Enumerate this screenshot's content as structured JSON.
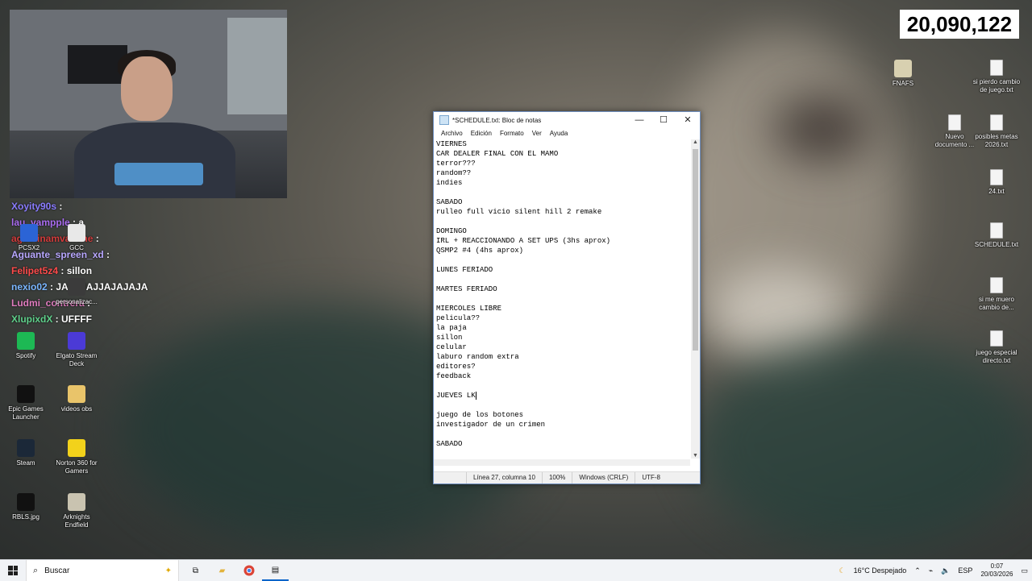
{
  "viewer_counter": "20,090,122",
  "chat": [
    {
      "user": "Xoyity90s",
      "user_color": "#8a7cff",
      "msg": ""
    },
    {
      "user": "lau_vampple",
      "user_color": "#a96cf0",
      "msg": "a"
    },
    {
      "user": "agustinamvallone",
      "user_color": "#d23b3b",
      "msg": ""
    },
    {
      "user": "Aguante_spreen_xd",
      "user_color": "#b8a7ff",
      "msg": ""
    },
    {
      "user": "Felipet5z4",
      "user_color": "#ff4b4b",
      "msg": "sillon"
    },
    {
      "user": "nexio02",
      "user_color": "#7ab6ff",
      "msg": "JAJAJAJJAJAJAJA"
    },
    {
      "user": "Ludmi_contrera",
      "user_color": "#e07cbf",
      "msg": ""
    },
    {
      "user": "XlupixdX",
      "user_color": "#5fd08b",
      "msg": "UFFFF"
    }
  ],
  "desktop_left": [
    {
      "label": "PCSX2",
      "icon": "pcsx2-icon"
    },
    {
      "label": "GCC",
      "icon": "gcc-icon"
    },
    {
      "label": "personalizac...",
      "icon": "personalize-icon"
    },
    {
      "label": "Spotify",
      "icon": "spotify-icon"
    },
    {
      "label": "Elgato Stream Deck",
      "icon": "stream-deck-icon"
    },
    {
      "label": "Epic Games Launcher",
      "icon": "epic-games-icon"
    },
    {
      "label": "videos obs",
      "icon": "folder-icon"
    },
    {
      "label": "Steam",
      "icon": "steam-icon"
    },
    {
      "label": "Norton 360 for Gamers",
      "icon": "norton-icon"
    },
    {
      "label": "RBLS.jpg",
      "icon": "image-icon"
    },
    {
      "label": "Arknights Endfield",
      "icon": "arknights-icon"
    }
  ],
  "desktop_right": [
    {
      "label": "FNAFS",
      "icon": "fnafs-icon"
    },
    {
      "label": "si pierdo cambio de juego.txt",
      "icon": "text-file-icon"
    },
    {
      "label": "Nuevo documento ...",
      "icon": "text-file-icon"
    },
    {
      "label": "posibles metas 2026.txt",
      "icon": "text-file-icon"
    },
    {
      "label": "24.txt",
      "icon": "text-file-icon"
    },
    {
      "label": "SCHEDULE.txt",
      "icon": "text-file-icon"
    },
    {
      "label": "si me muero cambio de...",
      "icon": "text-file-icon"
    },
    {
      "label": "juego especial directo.txt",
      "icon": "text-file-icon"
    }
  ],
  "notepad": {
    "title": "*SCHEDULE.txt: Bloc de notas",
    "controls": {
      "minimize": "—",
      "maximize": "☐",
      "close": "✕"
    },
    "menu": [
      "Archivo",
      "Edición",
      "Formato",
      "Ver",
      "Ayuda"
    ],
    "lines": [
      "VIERNES",
      "CAR DEALER FINAL CON EL MAMO",
      "terror???",
      "random??",
      "indies",
      "",
      "SABADO",
      "rulleo full vicio silent hill 2 remake",
      "",
      "DOMINGO",
      "IRL + REACCIONANDO A SET UPS (3hs aprox)",
      "QSMP2 #4 (4hs aprox)",
      "",
      "LUNES FERIADO",
      "",
      "MARTES FERIADO",
      "",
      "MIERCOLES LIBRE",
      "pelicula??",
      "la paja",
      "sillon",
      "celular",
      "laburo random extra",
      "editores?",
      "feedback",
      "",
      "JUEVES LK",
      "",
      "juego de los botones",
      "investigador de un crimen",
      "",
      "SABADO"
    ],
    "status": {
      "position": "Línea 27, columna 10",
      "zoom": "100%",
      "line_ending": "Windows (CRLF)",
      "encoding": "UTF-8"
    }
  },
  "taskbar": {
    "search_placeholder": "Buscar",
    "weather": "16°C Despejado",
    "language": "ESP",
    "time": "0:07",
    "date": "20/03/2026"
  }
}
